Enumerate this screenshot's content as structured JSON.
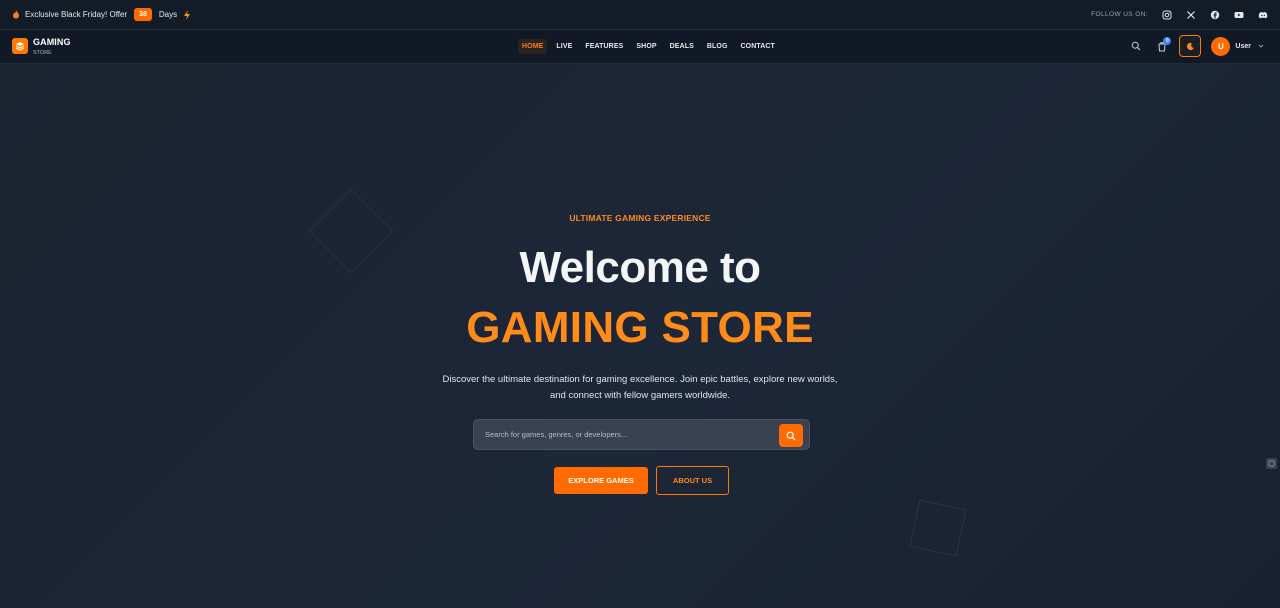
{
  "topbar": {
    "offer_text": "Exclusive Black Friday! Offer",
    "days_count": "38",
    "days_label": "Days",
    "follow_label": "FOLLOW US ON:",
    "socials": [
      "instagram-icon",
      "x-icon",
      "facebook-icon",
      "youtube-icon",
      "discord-icon"
    ]
  },
  "navbar": {
    "logo_title": "GAMING",
    "logo_sub": "STORE",
    "links": [
      "HOME",
      "LIVE",
      "FEATURES",
      "SHOP",
      "DEALS",
      "BLOG",
      "CONTACT"
    ],
    "active_link": "HOME",
    "cart_count": "0",
    "avatar_initial": "U",
    "user_name": "User"
  },
  "hero": {
    "eyebrow": "ULTIMATE GAMING EXPERIENCE",
    "headline_line1": "Welcome to",
    "headline_line2": "GAMING STORE",
    "description": "Discover the ultimate destination for gaming excellence. Join epic battles, explore new worlds, and connect with fellow gamers worldwide.",
    "search_placeholder": "Search for games, genres, or developers...",
    "primary_button": "EXPLORE GAMES",
    "secondary_button": "ABOUT US"
  },
  "colors": {
    "accent": "#ff6b00",
    "accent_text": "#ff8c1a",
    "background": "#1a2230",
    "topbar_bg": "#131b26",
    "navbar_bg": "#111926"
  }
}
